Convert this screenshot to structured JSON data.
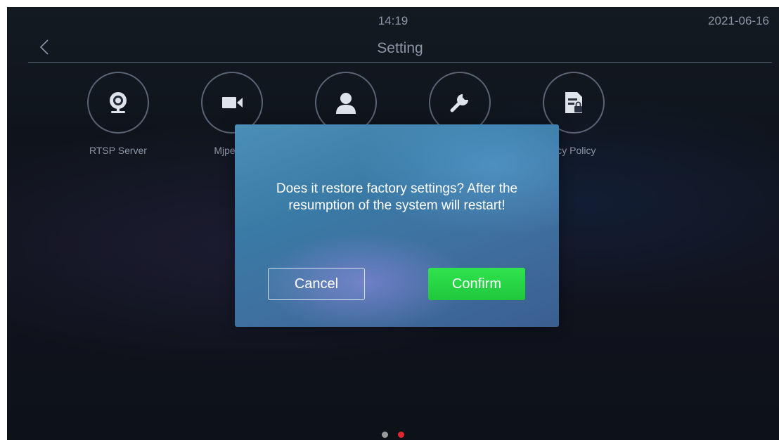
{
  "status_bar": {
    "time": "14:19",
    "date": "2021-06-16"
  },
  "header": {
    "title": "Setting",
    "back_icon": "chevron-left-icon"
  },
  "settings": [
    {
      "label": "RTSP Server",
      "icon": "webcam-icon"
    },
    {
      "label": "Mjpeg S",
      "icon": "video-camera-icon"
    },
    {
      "label": "",
      "icon": "user-icon"
    },
    {
      "label": "",
      "icon": "wrench-icon"
    },
    {
      "label": "acy Policy",
      "icon": "document-lock-icon"
    }
  ],
  "dialog": {
    "message_line1": "Does it restore factory settings? After the",
    "message_line2": "resumption of the system will restart!",
    "cancel_label": "Cancel",
    "confirm_label": "Confirm"
  },
  "pager": {
    "pages": 2,
    "active_index": 1
  },
  "colors": {
    "accent_green": "#20c83c",
    "page_dot_active": "#e0262f",
    "page_dot_inactive": "#9a9a9a"
  }
}
